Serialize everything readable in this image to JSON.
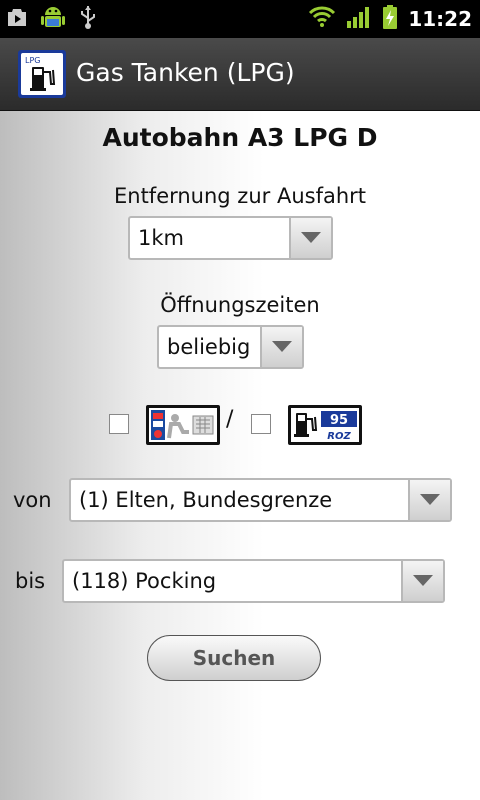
{
  "status_bar": {
    "time": "11:22",
    "icons": [
      "play-store-icon",
      "android-icon",
      "usb-icon",
      "wifi-icon",
      "signal-icon",
      "battery-charging-icon"
    ]
  },
  "app": {
    "title": "Gas Tanken (LPG)",
    "icon_label": "LPG"
  },
  "form": {
    "station_title": "Autobahn A3 LPG D",
    "distance_label": "Entfernung zur Ausfahrt",
    "distance_value": "1km",
    "hours_label": "Öffnungszeiten",
    "hours_value": "beliebig",
    "fuel_badge_number": "95",
    "fuel_badge_text": "ROZ",
    "slash": "/",
    "from_label": "von",
    "from_value": "(1) Elten, Bundesgrenze",
    "to_label": "bis",
    "to_value": "(118) Pocking",
    "search_button": "Suchen"
  }
}
